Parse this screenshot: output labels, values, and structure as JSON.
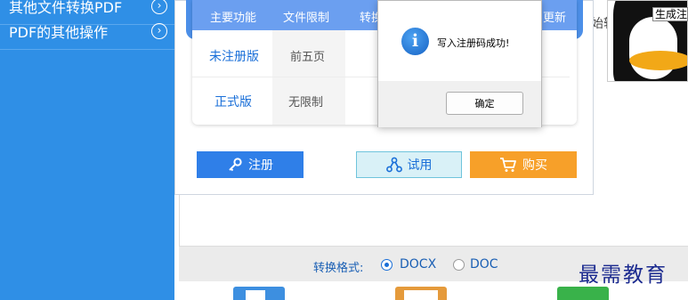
{
  "sidebar": {
    "items": [
      {
        "label": "其他文件转换PDF",
        "icon": "chevron-right-circle-icon"
      },
      {
        "label": "PDF的其他操作",
        "icon": "chevron-right-circle-icon"
      }
    ]
  },
  "register_panel": {
    "table": {
      "headers": [
        "主要功能",
        "文件限制",
        "转换",
        "更新"
      ],
      "rows": [
        {
          "edition": "未注册版",
          "limit": "前五页"
        },
        {
          "edition": "正式版",
          "limit": "无限制"
        }
      ]
    },
    "buttons": {
      "register": "注册",
      "trial": "试用",
      "buy": "购买"
    }
  },
  "message_dialog": {
    "message": "写入注册码成功!",
    "ok_label": "确定",
    "icon": "info-icon"
  },
  "main": {
    "format_label": "转换格式:",
    "format_options": [
      {
        "label": "DOCX",
        "selected": true
      },
      {
        "label": "DOC",
        "selected": false
      }
    ],
    "partial_text": "始转",
    "watermark": "最需教育"
  },
  "right_panel": {
    "generate_button": "生成注册码"
  },
  "colors": {
    "sidebar": "#2f8fe6",
    "table_header": "#6b9ff0",
    "register_button": "#2f7fe8",
    "trial_button": "#d9f1f7",
    "buy_button": "#f7a029"
  }
}
